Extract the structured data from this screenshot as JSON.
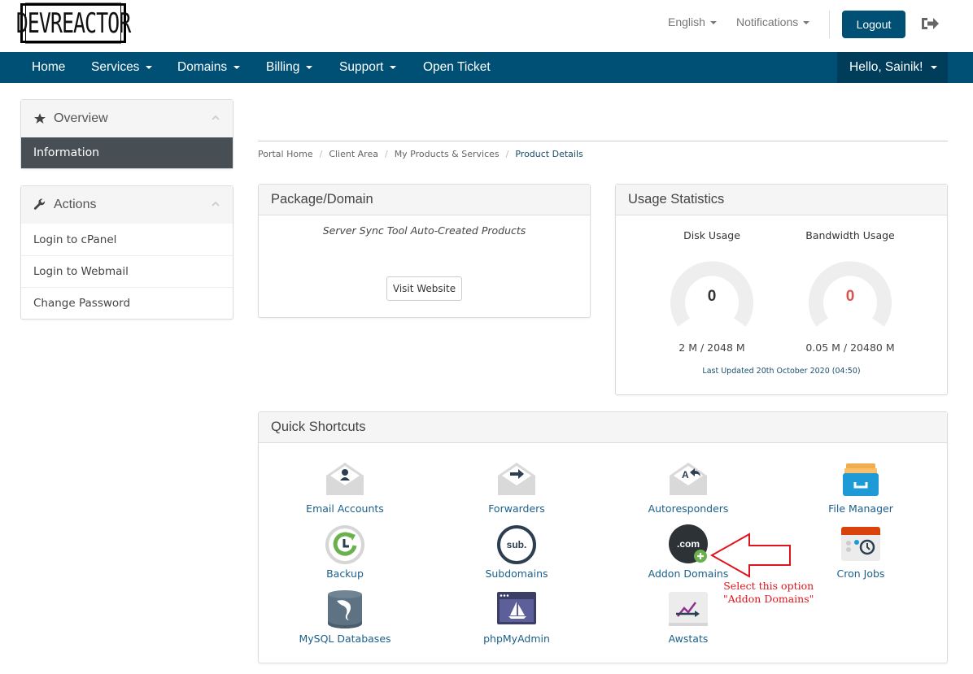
{
  "header": {
    "logo_text": "DEVREACTOR",
    "language": "English",
    "notifications": "Notifications",
    "logout_label": "Logout",
    "logout_icon": "sign-out-icon"
  },
  "nav": {
    "items": [
      {
        "label": "Home",
        "dropdown": false
      },
      {
        "label": "Services",
        "dropdown": true
      },
      {
        "label": "Domains",
        "dropdown": true
      },
      {
        "label": "Billing",
        "dropdown": true
      },
      {
        "label": "Support",
        "dropdown": true
      },
      {
        "label": "Open Ticket",
        "dropdown": false
      }
    ],
    "user_greeting": "Hello, Sainik!"
  },
  "sidebar": {
    "overview": {
      "title": "Overview",
      "icon": "star-icon",
      "items": [
        {
          "label": "Information",
          "active": true
        }
      ]
    },
    "actions": {
      "title": "Actions",
      "icon": "wrench-icon",
      "items": [
        {
          "label": "Login to cPanel"
        },
        {
          "label": "Login to Webmail"
        },
        {
          "label": "Change Password"
        }
      ]
    }
  },
  "breadcrumb": [
    "Portal Home",
    "Client Area",
    "My Products & Services",
    "Product Details"
  ],
  "package_panel": {
    "title": "Package/Domain",
    "product": "Server Sync Tool Auto-Created Products",
    "visit_button": "Visit Website"
  },
  "usage_panel": {
    "title": "Usage Statistics",
    "disk": {
      "label": "Disk Usage",
      "percent": "0",
      "usage": "2 M / 2048 M",
      "color": "#333333"
    },
    "bandwidth": {
      "label": "Bandwidth Usage",
      "percent": "0",
      "usage": "0.05 M / 20480 M",
      "color": "#d9534f"
    },
    "last_updated": "Last Updated 20th October 2020 (04:50)"
  },
  "shortcuts_panel": {
    "title": "Quick Shortcuts",
    "items": [
      {
        "label": "Email Accounts",
        "icon": "email-accounts-icon"
      },
      {
        "label": "Forwarders",
        "icon": "forwarders-icon"
      },
      {
        "label": "Autoresponders",
        "icon": "autoresponders-icon"
      },
      {
        "label": "File Manager",
        "icon": "file-manager-icon"
      },
      {
        "label": "Backup",
        "icon": "backup-icon"
      },
      {
        "label": "Subdomains",
        "icon": "subdomains-icon"
      },
      {
        "label": "Addon Domains",
        "icon": "addon-domains-icon"
      },
      {
        "label": "Cron Jobs",
        "icon": "cron-jobs-icon"
      },
      {
        "label": "MySQL Databases",
        "icon": "mysql-databases-icon"
      },
      {
        "label": "phpMyAdmin",
        "icon": "phpmyadmin-icon"
      },
      {
        "label": "Awstats",
        "icon": "awstats-icon"
      }
    ]
  },
  "annotation": {
    "line1": "Select this option",
    "line2": "\"Addon Domains\"",
    "color": "#e0141e"
  },
  "colors": {
    "brand": "#005075",
    "brand_dark": "#003d5b",
    "link": "#1a5f8a"
  }
}
